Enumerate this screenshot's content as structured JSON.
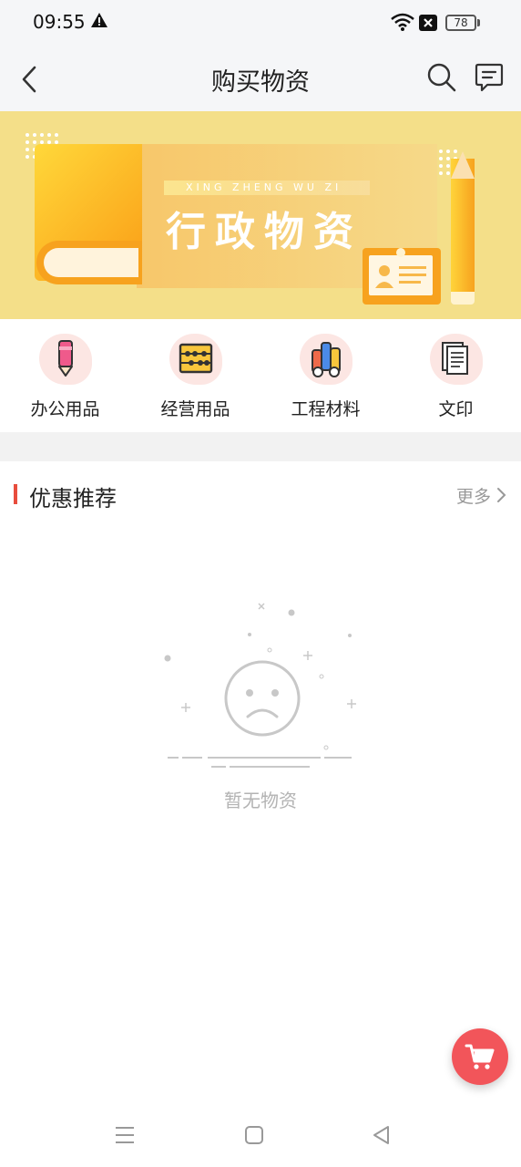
{
  "status_bar": {
    "time": "09:55",
    "battery": "78"
  },
  "nav": {
    "title": "购买物资"
  },
  "banner": {
    "subtitle": "XING ZHENG WU ZI",
    "title": "行政物资"
  },
  "categories": [
    {
      "label": "办公用品",
      "icon": "pencil-icon"
    },
    {
      "label": "经营用品",
      "icon": "abacus-icon"
    },
    {
      "label": "工程材料",
      "icon": "materials-icon"
    },
    {
      "label": "文印",
      "icon": "documents-icon"
    }
  ],
  "section": {
    "title": "优惠推荐",
    "more": "更多"
  },
  "empty": {
    "text": "暂无物资"
  },
  "colors": {
    "accent": "#e84d3d",
    "cart": "#f2555a",
    "banner_bg": "#f4df89"
  }
}
